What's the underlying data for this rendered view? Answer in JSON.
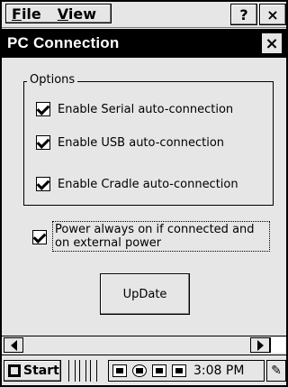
{
  "menubar": {
    "file_mnemonic": "F",
    "file_rest": "ile",
    "view_mnemonic": "V",
    "view_rest": "iew",
    "help_label": "?",
    "close_label": "×"
  },
  "dialog": {
    "title": "PC Connection",
    "close_label": "×"
  },
  "options": {
    "group_label": "Options",
    "items": [
      {
        "label": "Enable Serial auto-connection",
        "checked": true
      },
      {
        "label": "Enable USB auto-connection",
        "checked": true
      },
      {
        "label": "Enable Cradle auto-connection",
        "checked": true
      }
    ]
  },
  "power": {
    "label": "Power always on if connected and on external power",
    "checked": true
  },
  "update_button": {
    "label": "UpDate"
  },
  "taskbar": {
    "start_label": "Start",
    "time": "3:08 PM"
  },
  "icons": {
    "start": "windows-flag-icon",
    "tray": [
      "sync-icon",
      "globe-icon",
      "battery-icon",
      "keyboard-icon"
    ],
    "edit": "pen-icon"
  }
}
